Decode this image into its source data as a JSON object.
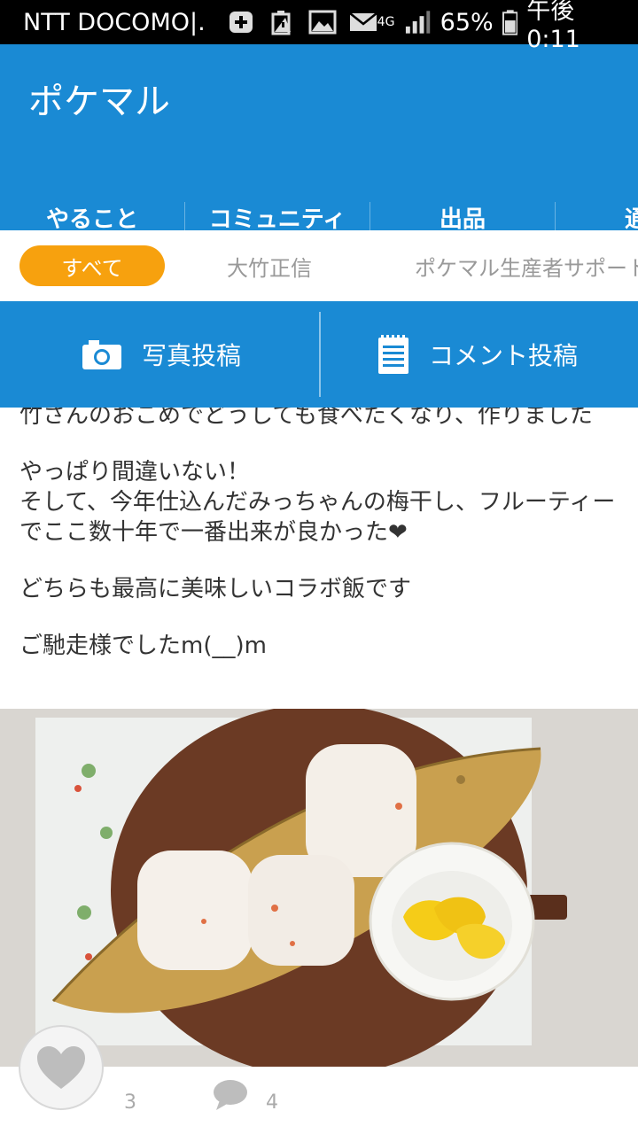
{
  "status_bar": {
    "carrier": "NTT DOCOMO|.",
    "network": "4G",
    "battery": "65%",
    "time": "午後0:11",
    "icons": [
      "plus-icon",
      "battery-warning-icon",
      "image-icon",
      "mail-icon"
    ]
  },
  "app": {
    "title": "ポケマル",
    "accent_color": "#1a8ad4",
    "chip_color": "#f7a10e"
  },
  "tabs": [
    {
      "label": "やること"
    },
    {
      "label": "コミュニティ",
      "selected": true
    },
    {
      "label": "出品"
    },
    {
      "label": "通"
    }
  ],
  "filters": [
    {
      "label": "すべて",
      "selected": true
    },
    {
      "label": "大竹正信"
    },
    {
      "label": "ポケマル生産者サポート"
    }
  ],
  "actions": {
    "photo_post": "写真投稿",
    "comment_post": "コメント投稿"
  },
  "post": {
    "lines": [
      "竹さんのおこめでどうしても食べたくなり、作りました",
      "やっぱり間違いない！",
      "そして、今年仕込んだみっちゃんの梅干し、フルーティーでここ数十年で一番出来が良かった❤",
      "どちらも最高に美味しいコラボ飯です",
      "ご馳走様でしたm(__)m"
    ]
  },
  "footer": {
    "like_count": "3",
    "comment_count": "4"
  }
}
